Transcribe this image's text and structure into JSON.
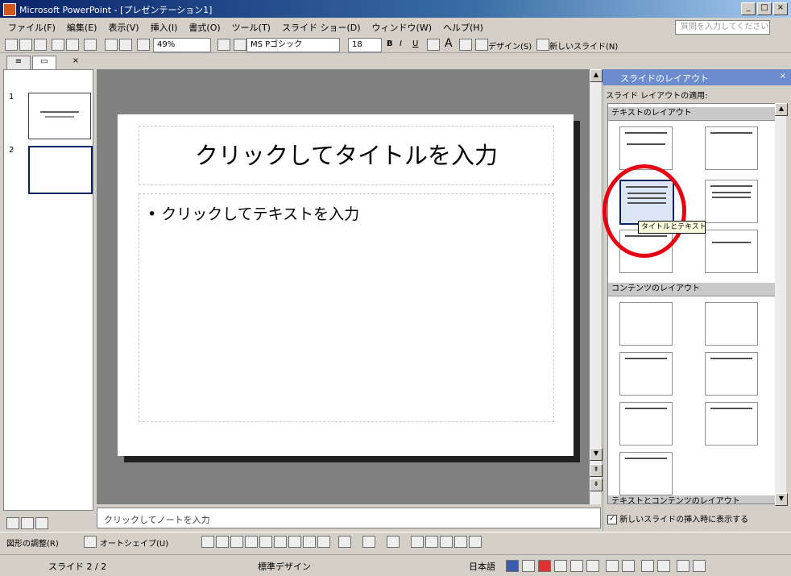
{
  "window": {
    "title": "Microsoft PowerPoint - [プレゼンテーション1]"
  },
  "menu": {
    "items": [
      "ファイル(F)",
      "編集(E)",
      "表示(V)",
      "挿入(I)",
      "書式(O)",
      "ツール(T)",
      "スライド ショー(D)",
      "ウィンドウ(W)",
      "ヘルプ(H)"
    ],
    "ask_placeholder": "質問を入力してください"
  },
  "toolbar": {
    "zoom": "49%",
    "font_name": "MS Pゴシック",
    "font_size": "18",
    "design_label": "デザイン(S)",
    "new_slide_label": "新しいスライド(N)"
  },
  "slides_pane": {
    "slide_numbers": [
      "1",
      "2"
    ]
  },
  "slide": {
    "title_placeholder": "クリックしてタイトルを入力",
    "body_placeholder": "• クリックしてテキストを入力"
  },
  "notes": {
    "placeholder": "クリックしてノートを入力"
  },
  "task_pane": {
    "title": "スライドのレイアウト",
    "apply_label": "スライド レイアウトの適用:",
    "section_text": "テキストのレイアウト",
    "section_content": "コンテンツのレイアウト",
    "section_text_content": "テキストとコンテンツのレイアウト",
    "tooltip": "タイトルとテキスト",
    "show_on_insert": "新しいスライドの挿入時に表示する"
  },
  "drawing": {
    "draw_label": "図形の調整(R)",
    "autoshape_label": "オートシェイプ(U)"
  },
  "status": {
    "slide_pos": "スライド 2 / 2",
    "design": "標準デザイン",
    "language": "日本語"
  },
  "colors": {
    "highlight": "#e60012",
    "taskpane_header": "#6d8ccd",
    "titlebar": "#0a246a"
  }
}
